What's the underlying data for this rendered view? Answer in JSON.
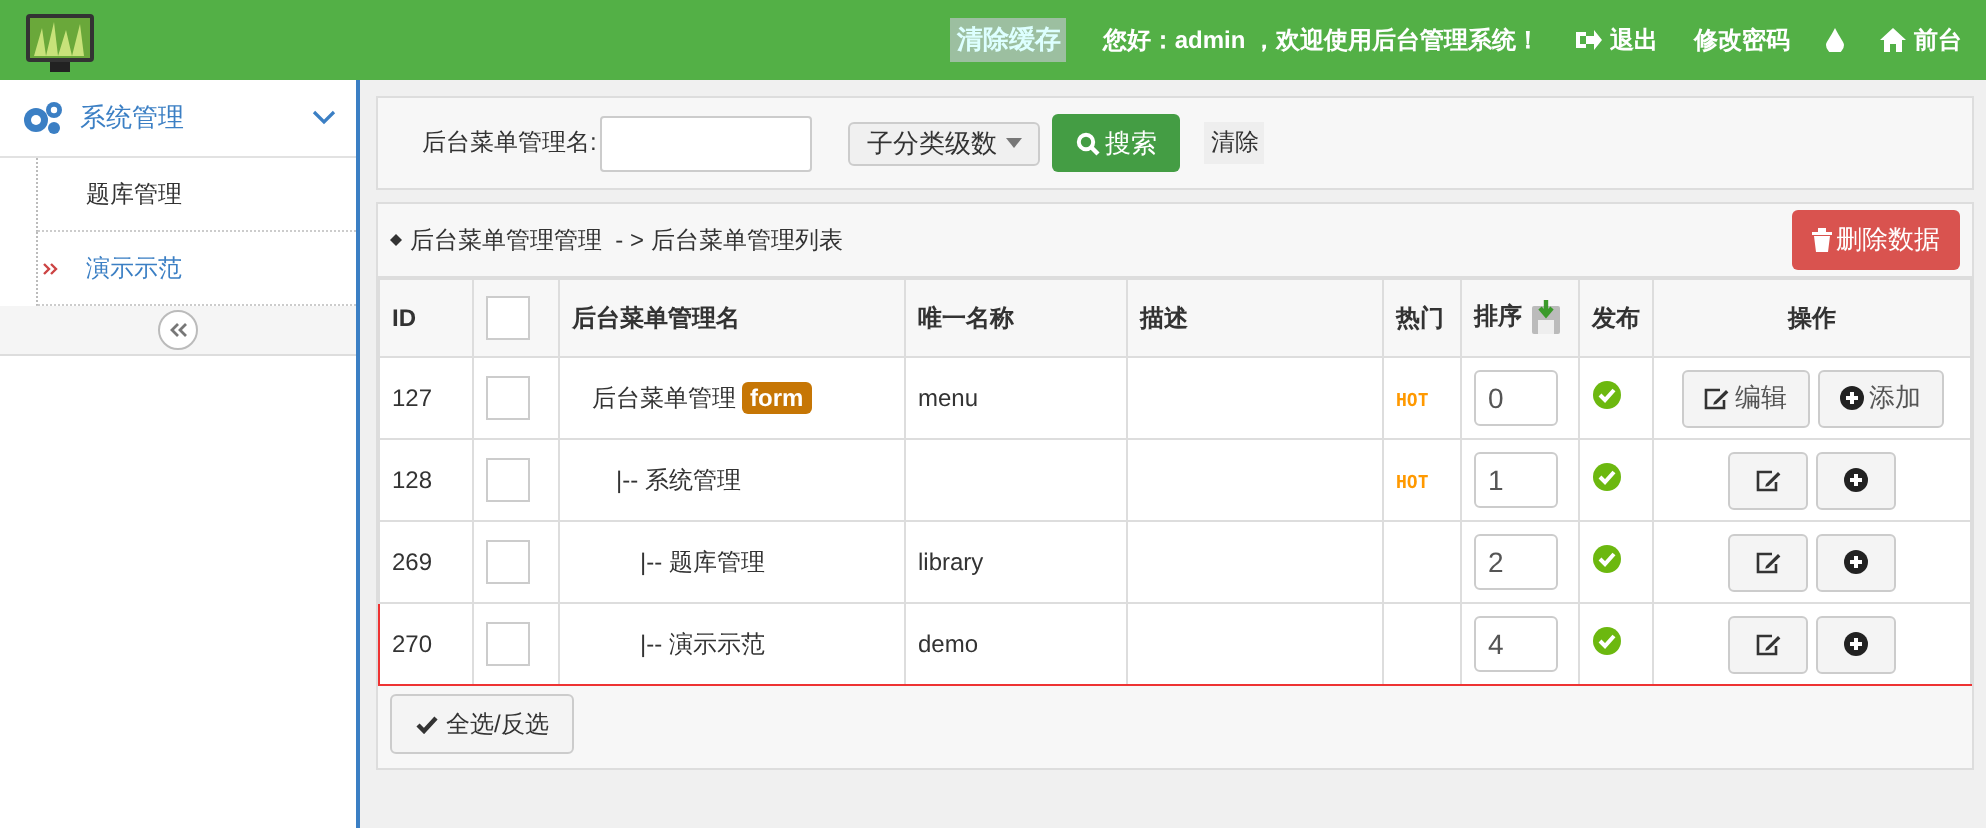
{
  "header": {
    "clear_cache": "清除缓存",
    "greeting": "您好：admin ，欢迎使用后台管理系统！",
    "links": [
      {
        "kind": "logout",
        "label": "退出"
      },
      {
        "kind": "password",
        "label": "修改密码"
      },
      {
        "kind": "drop"
      },
      {
        "kind": "home",
        "label": "前台"
      }
    ]
  },
  "sidebar": {
    "group": {
      "label": "系统管理",
      "expanded": true
    },
    "items": [
      {
        "label": "题库管理",
        "selected": false
      },
      {
        "label": "演示示范",
        "selected": true
      }
    ]
  },
  "search": {
    "label": "后台菜单管理名:",
    "select": "子分类级数",
    "search_button": "搜索",
    "clear": "清除"
  },
  "breadcrumb": {
    "parent": "后台菜单管理管理",
    "separator": "- >",
    "current": "后台菜单管理列表"
  },
  "delete_button": "删除数据",
  "table": {
    "columns": [
      "ID",
      "",
      "后台菜单管理名",
      "唯一名称",
      "描述",
      "热门",
      "排序",
      "发布",
      "操作"
    ],
    "all_checked": false,
    "rows": [
      {
        "id": "127",
        "checked": false,
        "name": "后台菜单管理",
        "badge": "form",
        "unique": "menu",
        "hot": "HOT",
        "sort": "0",
        "published": true,
        "highlighted": false,
        "actions": [
          {
            "kind": "edit",
            "label": "编辑"
          },
          {
            "kind": "add",
            "label": "添加"
          }
        ],
        "children": [
          {
            "id": "128",
            "checked": false,
            "name": "|-- 系统管理",
            "hot": "HOT",
            "sort": "1",
            "published": true,
            "highlighted": false,
            "actions": [
              {
                "kind": "edit"
              },
              {
                "kind": "add"
              }
            ],
            "children": [
              {
                "id": "269",
                "checked": false,
                "name": "|-- 题库管理",
                "unique": "library",
                "sort": "2",
                "published": true,
                "highlighted": false,
                "actions": [
                  {
                    "kind": "edit"
                  },
                  {
                    "kind": "add"
                  }
                ]
              },
              {
                "id": "270",
                "checked": false,
                "name": "|-- 演示示范",
                "unique": "demo",
                "sort": "4",
                "published": true,
                "highlighted": true,
                "actions": [
                  {
                    "kind": "edit"
                  },
                  {
                    "kind": "add"
                  }
                ]
              }
            ]
          }
        ]
      }
    ]
  },
  "select_all_button": "全选/反选"
}
